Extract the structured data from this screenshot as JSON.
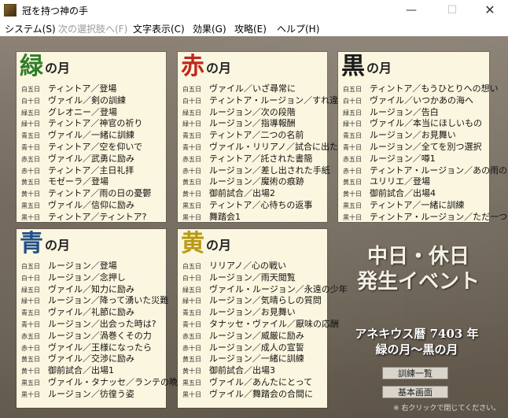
{
  "window": {
    "title": "冠を持つ神の手",
    "min_glyph": "—",
    "max_glyph": "☐",
    "close_glyph": "✕"
  },
  "menu": [
    {
      "label": "システム(S)",
      "enabled": true
    },
    {
      "label": "次の選択肢へ(F)",
      "enabled": false
    },
    {
      "label": "文字表示(C)",
      "enabled": true
    },
    {
      "label": "効果(G)",
      "enabled": true
    },
    {
      "label": "攻略(E)",
      "enabled": true
    },
    {
      "label": "ヘルプ(H)",
      "enabled": true
    }
  ],
  "panels": {
    "green": {
      "kanji": "緑",
      "suffix": "の月",
      "color": "#2f7d2b",
      "events": [
        {
          "date": "白五日",
          "title": "ティントア／登場"
        },
        {
          "date": "白十日",
          "title": "ヴァイル／剣の訓練"
        },
        {
          "date": "緑五日",
          "title": "グレオニー／登場"
        },
        {
          "date": "緑十日",
          "title": "ティントア／神官の祈り"
        },
        {
          "date": "青五日",
          "title": "ヴァイル／一緒に訓練"
        },
        {
          "date": "青十日",
          "title": "ティントア／空を仰いで"
        },
        {
          "date": "赤五日",
          "title": "ヴァイル／武勇に励み"
        },
        {
          "date": "赤十日",
          "title": "ティントア／主日礼拝"
        },
        {
          "date": "黄五日",
          "title": "モゼーラ／登場"
        },
        {
          "date": "黄十日",
          "title": "ティントア／雨の日の憂鬱"
        },
        {
          "date": "黒五日",
          "title": "ヴァイル／信仰に励み"
        },
        {
          "date": "黒十日",
          "title": "ティントア／ティントア?"
        }
      ]
    },
    "red": {
      "kanji": "赤",
      "suffix": "の月",
      "color": "#c0271e",
      "events": [
        {
          "date": "白五日",
          "title": "ヴァイル／いざ尋常に"
        },
        {
          "date": "白十日",
          "title": "ティントア・ルージョン／すれ違い"
        },
        {
          "date": "緑五日",
          "title": "ルージョン／次の段階"
        },
        {
          "date": "緑十日",
          "title": "ルージョン／指導報酬"
        },
        {
          "date": "青五日",
          "title": "ティントア／二つの名前"
        },
        {
          "date": "青十日",
          "title": "ヴァイル・リリアノ／試合に出たい"
        },
        {
          "date": "赤五日",
          "title": "ティントア／託された書簡"
        },
        {
          "date": "赤十日",
          "title": "ルージョン／差し出された手紙"
        },
        {
          "date": "黄五日",
          "title": "ルージョン／魔術の痕跡"
        },
        {
          "date": "黄十日",
          "title": "御前試合／出場2"
        },
        {
          "date": "黒五日",
          "title": "ティントア／心待ちの返事"
        },
        {
          "date": "黒十日",
          "title": "舞踏会1"
        }
      ]
    },
    "black": {
      "kanji": "黒",
      "suffix": "の月",
      "color": "#1a1a1a",
      "events": [
        {
          "date": "白五日",
          "title": "ティントア／もうひとりへの想い"
        },
        {
          "date": "白十日",
          "title": "ヴァイル／いつかあの海へ"
        },
        {
          "date": "緑五日",
          "title": "ルージョン／告白"
        },
        {
          "date": "緑十日",
          "title": "ヴァイル／本当にほしいもの"
        },
        {
          "date": "青五日",
          "title": "ルージョン／お見舞い"
        },
        {
          "date": "青十日",
          "title": "ルージョン／全てを別つ選択"
        },
        {
          "date": "赤五日",
          "title": "ルージョン／噂1"
        },
        {
          "date": "赤十日",
          "title": "ティントア・ルージョン／あの雨の日"
        },
        {
          "date": "黄五日",
          "title": "ユリリエ／登場"
        },
        {
          "date": "黄十日",
          "title": "御前試合／出場4"
        },
        {
          "date": "黒五日",
          "title": "ティントア／一緒に訓練"
        },
        {
          "date": "黒十日",
          "title": "ティントア・ルージョン／ただ一つの期待"
        }
      ]
    },
    "blue": {
      "kanji": "青",
      "suffix": "の月",
      "color": "#1f4f86",
      "events": [
        {
          "date": "白五日",
          "title": "ルージョン／登場"
        },
        {
          "date": "白十日",
          "title": "ルージョン／念押し"
        },
        {
          "date": "緑五日",
          "title": "ヴァイル／知力に励み"
        },
        {
          "date": "緑十日",
          "title": "ルージョン／降って湧いた災難"
        },
        {
          "date": "青五日",
          "title": "ヴァイル／礼節に励み"
        },
        {
          "date": "青十日",
          "title": "ルージョン／出会った時は?"
        },
        {
          "date": "赤五日",
          "title": "ルージョン／渦巻くその力"
        },
        {
          "date": "赤十日",
          "title": "ヴァイル／王様になったら"
        },
        {
          "date": "黄五日",
          "title": "ヴァイル／交渉に励み"
        },
        {
          "date": "黄十日",
          "title": "御前試合／出場1"
        },
        {
          "date": "黒五日",
          "title": "ヴァイル・タナッセ／ランテの晩餐"
        },
        {
          "date": "黒十日",
          "title": "ルージョン／彷徨う姿"
        }
      ]
    },
    "yellow": {
      "kanji": "黄",
      "suffix": "の月",
      "color": "#b99a12",
      "events": [
        {
          "date": "白五日",
          "title": "リリアノ／心の戦い"
        },
        {
          "date": "白十日",
          "title": "ルージョン／雨天閲覧"
        },
        {
          "date": "緑五日",
          "title": "ヴァイル・ルージョン／永遠の少年"
        },
        {
          "date": "緑十日",
          "title": "ルージョン／気晴らしの質問"
        },
        {
          "date": "青五日",
          "title": "ルージョン／お見舞い"
        },
        {
          "date": "青十日",
          "title": "タナッセ・ヴァイル／厭味の応酬"
        },
        {
          "date": "赤五日",
          "title": "ルージョン／威厳に励み"
        },
        {
          "date": "赤十日",
          "title": "ルージョン／成人の宣誓"
        },
        {
          "date": "黄五日",
          "title": "ルージョン／一緒に訓練"
        },
        {
          "date": "黄十日",
          "title": "御前試合／出場3"
        },
        {
          "date": "黒五日",
          "title": "ヴァイル／あんたにとって"
        },
        {
          "date": "黒十日",
          "title": "ヴァイル／舞踏会の合間に"
        }
      ]
    }
  },
  "side": {
    "title_line1": "中日・休日",
    "title_line2": "発生イベント",
    "sub_line1": "アネキウス暦 7403 年",
    "sub_line2": "緑の月～黒の月",
    "btn_training": "訓練一覧",
    "btn_basic": "基本画面",
    "hint": "※ 右クリックで閉じてください。"
  }
}
